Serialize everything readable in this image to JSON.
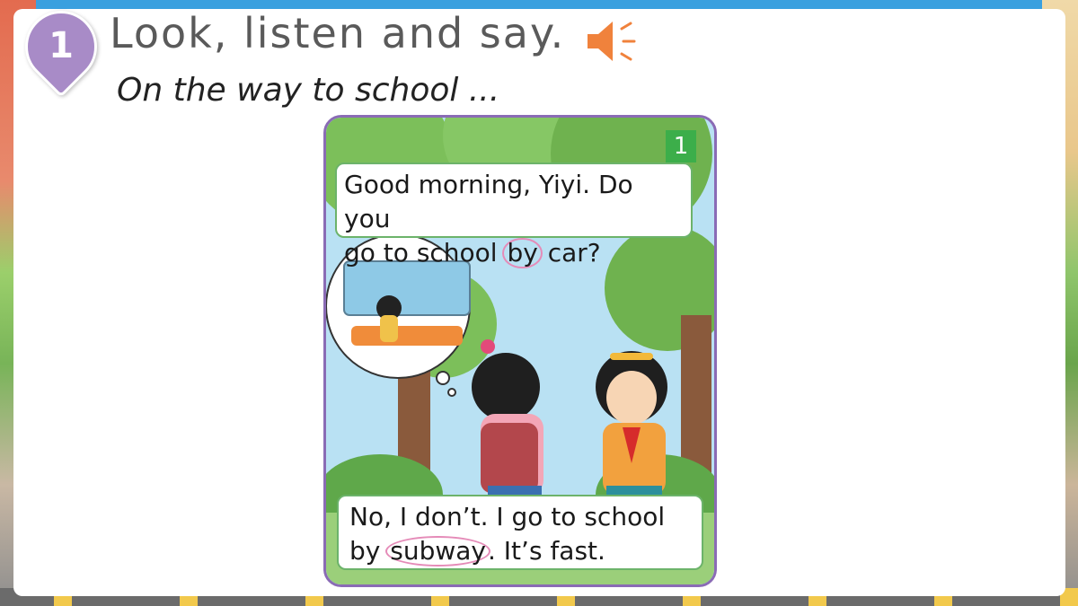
{
  "lesson": {
    "number": "1",
    "heading": "Look, listen and say.",
    "subtitle": "On the way to school ..."
  },
  "icons": {
    "speaker": "speaker-icon"
  },
  "colors": {
    "badge": "#a88bc7",
    "panel_border": "#8a6bb5",
    "panel_number_bg": "#3cae4a",
    "circle_highlight": "#e58bb8",
    "speaker": "#f0823c"
  },
  "panel": {
    "number": "1",
    "bubble_top": {
      "line1": "Good morning, Yiyi. Do you",
      "line2_before": "go to school ",
      "line2_highlight": "by",
      "line2_after": " car?"
    },
    "bubble_bottom": {
      "line1": "No, I don’t. I go to school",
      "line2_before": "by ",
      "line2_highlight": "subway",
      "line2_after": ". It’s fast."
    }
  }
}
